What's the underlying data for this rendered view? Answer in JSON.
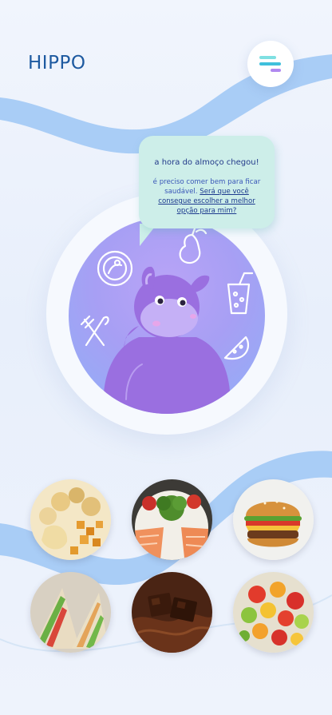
{
  "app": {
    "title": "HIPPO"
  },
  "menu": {
    "icon": "hamburger-menu-icon"
  },
  "bubble": {
    "heading": "a hora do almoço chegou!",
    "text": "é preciso comer bem para ficar saudável.",
    "link": "Será que você consegue escolher a melhor opção para mim?"
  },
  "mascot": {
    "icon": "hippo-mascot",
    "decor": [
      "pear-icon",
      "juice-cup-icon",
      "plate-icon",
      "fork-knife-icon",
      "watermelon-icon"
    ]
  },
  "foods": [
    {
      "icon": "chips-snacks-icon"
    },
    {
      "icon": "salmon-rice-bowl-icon"
    },
    {
      "icon": "hamburger-icon"
    },
    {
      "icon": "sandwich-icon"
    },
    {
      "icon": "chocolate-icon"
    },
    {
      "icon": "fruit-salad-icon"
    }
  ],
  "colors": {
    "accent": "#1e5aa0",
    "wave": "#a9cdf6",
    "bubble": "#cdeee9",
    "hippo": "#9a6fe0"
  }
}
